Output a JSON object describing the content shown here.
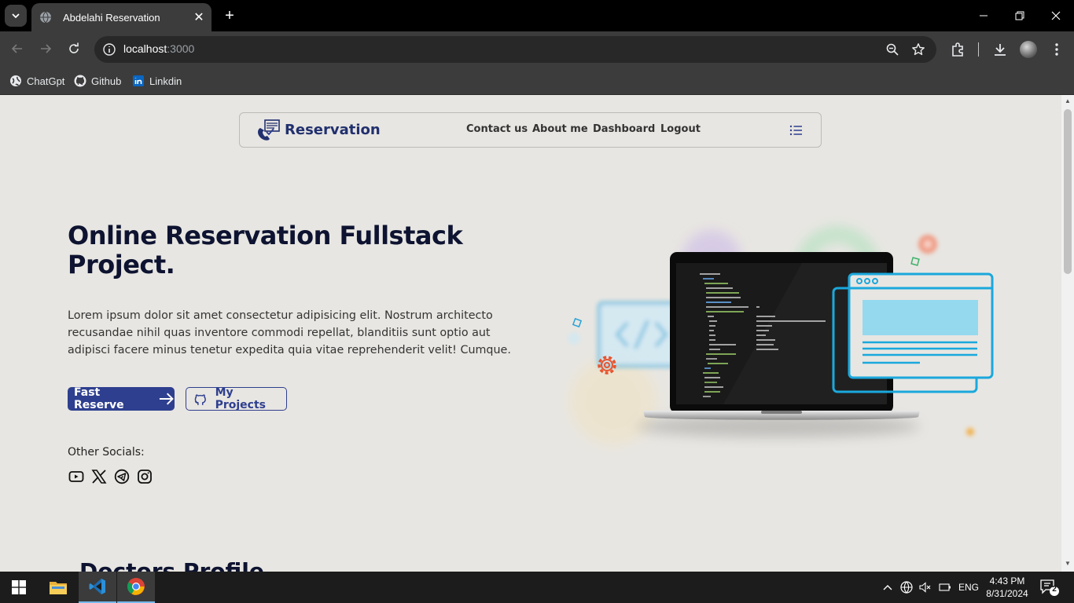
{
  "browser": {
    "tab_title": "Abdelahi Reservation",
    "url_host": "localhost",
    "url_port": ":3000",
    "bookmarks": [
      {
        "label": "ChatGpt",
        "icon": "globe-icon"
      },
      {
        "label": "Github",
        "icon": "github-icon"
      },
      {
        "label": "Linkdin",
        "icon": "linkedin-icon"
      }
    ]
  },
  "site": {
    "brand": "Reservation",
    "nav": [
      {
        "label": "Contact us"
      },
      {
        "label": "About me"
      },
      {
        "label": "Dashboard"
      },
      {
        "label": "Logout"
      }
    ],
    "hero_title": "Online Reservation Fullstack Project.",
    "hero_text": "Lorem ipsum dolor sit amet consectetur adipisicing elit. Nostrum architecto recusandae nihil quas inventore commodi repellat, blanditiis sunt optio aut adipisci facere minus tenetur expedita quia vitae reprehenderit velit! Cumque.",
    "fast_reserve": "Fast Reserve",
    "my_projects": "My Projects",
    "other_socials": "Other Socials:",
    "socials": [
      "youtube-icon",
      "x-icon",
      "telegram-icon",
      "instagram-icon"
    ],
    "next_section_title": "Doctors Profile"
  },
  "taskbar": {
    "lang": "ENG",
    "time": "4:43 PM",
    "date": "8/31/2024",
    "notifications": "2"
  },
  "colors": {
    "brand_blue": "#2e3f8f",
    "page_bg": "#e8e6e2",
    "heading": "#0d1330"
  }
}
